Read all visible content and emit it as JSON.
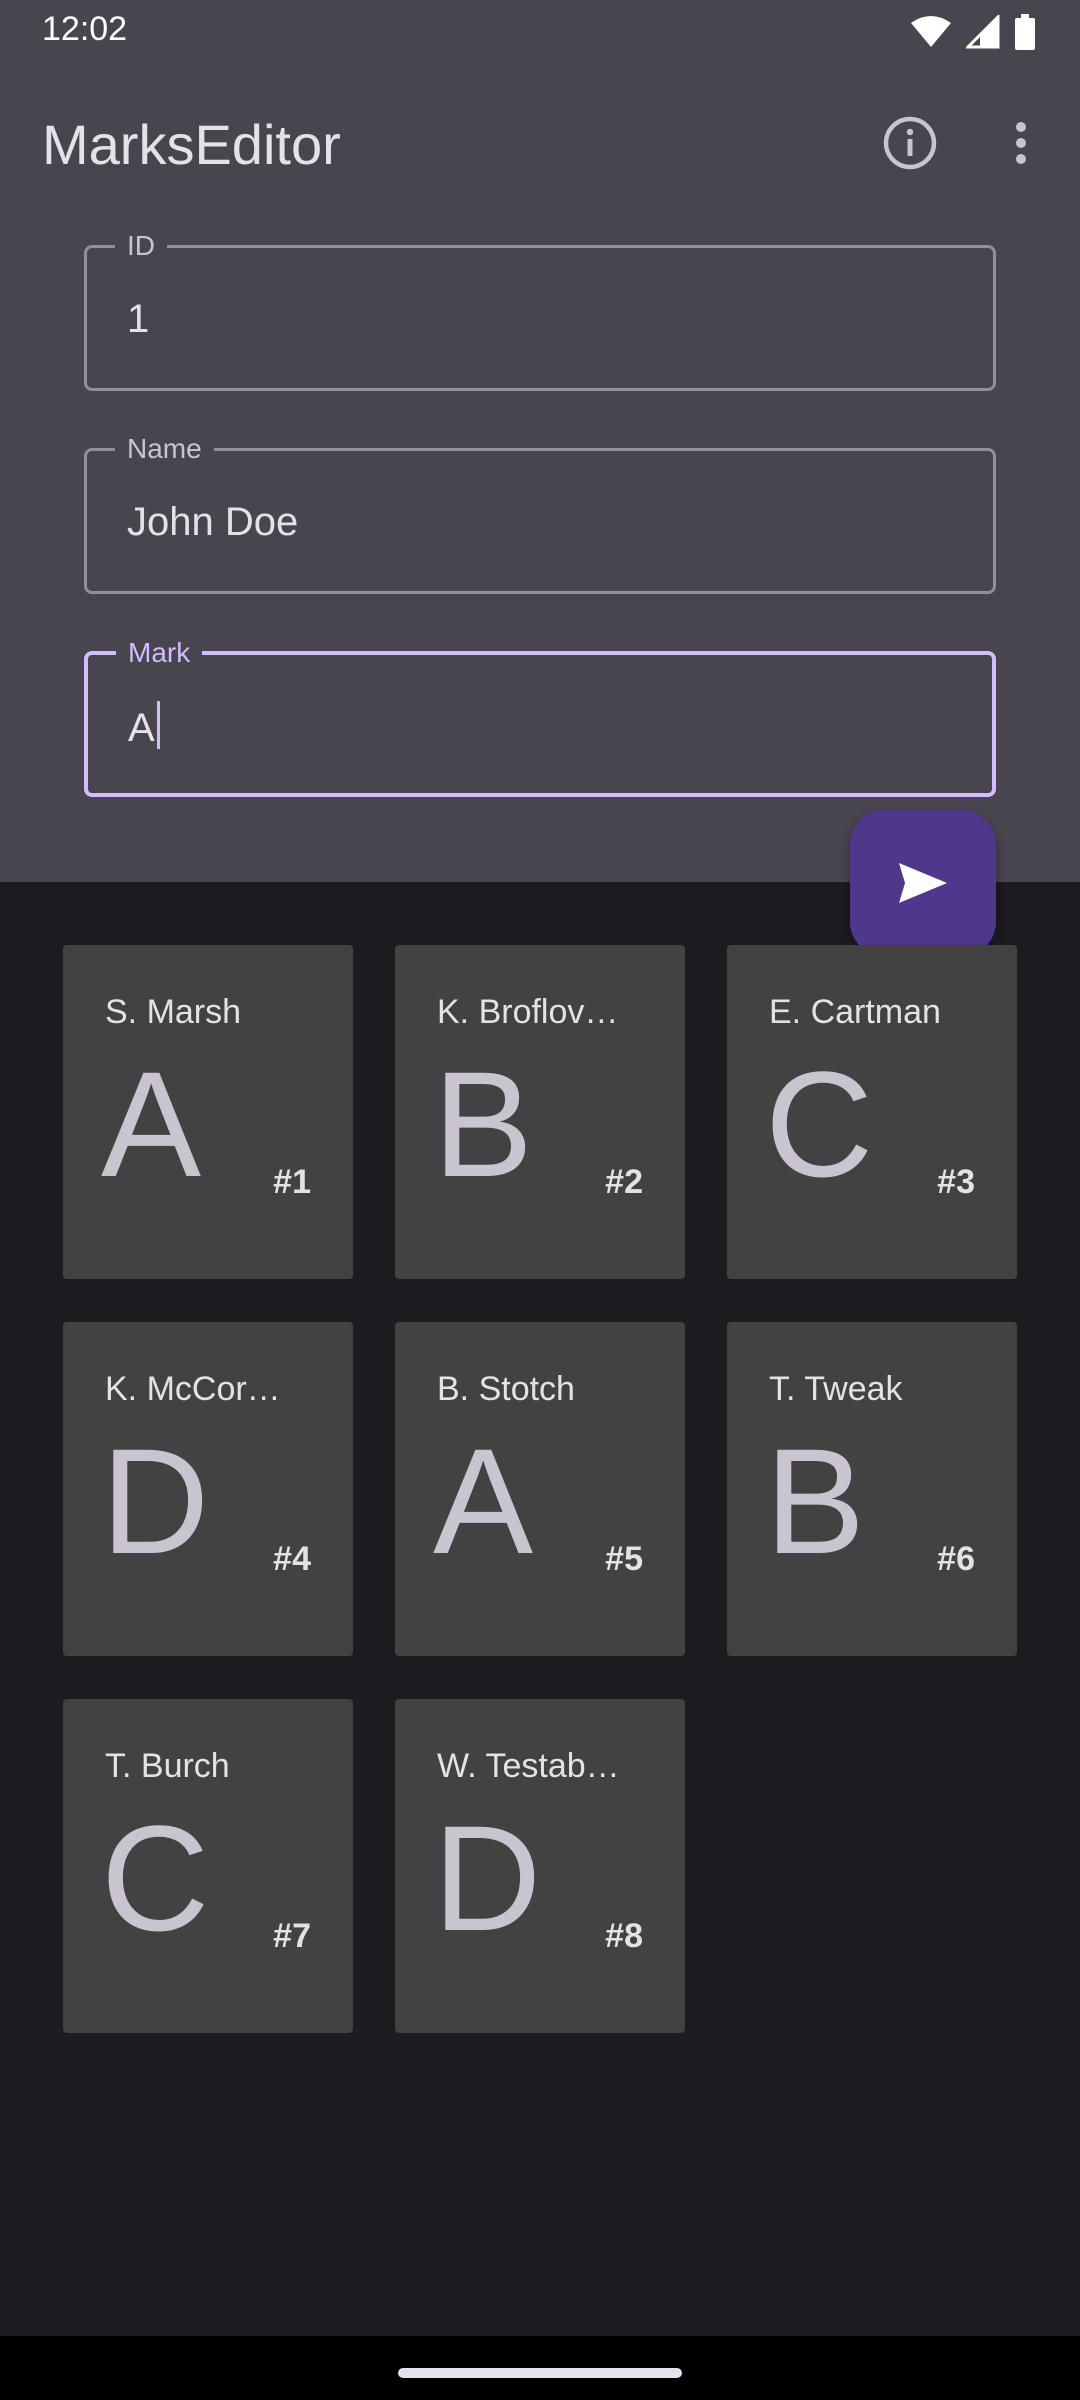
{
  "status_bar": {
    "time": "12:02",
    "icons": [
      "wifi-icon",
      "signal-icon",
      "battery-icon"
    ]
  },
  "app_bar": {
    "title": "MarksEditor",
    "actions": [
      "info-icon",
      "more-vert-icon"
    ]
  },
  "form": {
    "id_field": {
      "label": "ID",
      "value": "1"
    },
    "name_field": {
      "label": "Name",
      "value": "John Doe"
    },
    "mark_field": {
      "label": "Mark",
      "value": "A",
      "focused": true
    }
  },
  "fab": {
    "icon": "send-icon"
  },
  "cards": [
    {
      "name": "S. Marsh",
      "grade": "A",
      "number": "#1"
    },
    {
      "name": "K. Broflov…",
      "grade": "B",
      "number": "#2"
    },
    {
      "name": "E. Cartman",
      "grade": "C",
      "number": "#3"
    },
    {
      "name": "K. McCor…",
      "grade": "D",
      "number": "#4"
    },
    {
      "name": "B. Stotch",
      "grade": "A",
      "number": "#5"
    },
    {
      "name": "T. Tweak",
      "grade": "B",
      "number": "#6"
    },
    {
      "name": "T. Burch",
      "grade": "C",
      "number": "#7"
    },
    {
      "name": "W. Testab…",
      "grade": "D",
      "number": "#8"
    }
  ],
  "colors": {
    "top_background": "#49454f",
    "body_background": "#1d1b20",
    "card_background": "#424242",
    "accent": "#d0bcff",
    "fab": "#4f378b"
  }
}
